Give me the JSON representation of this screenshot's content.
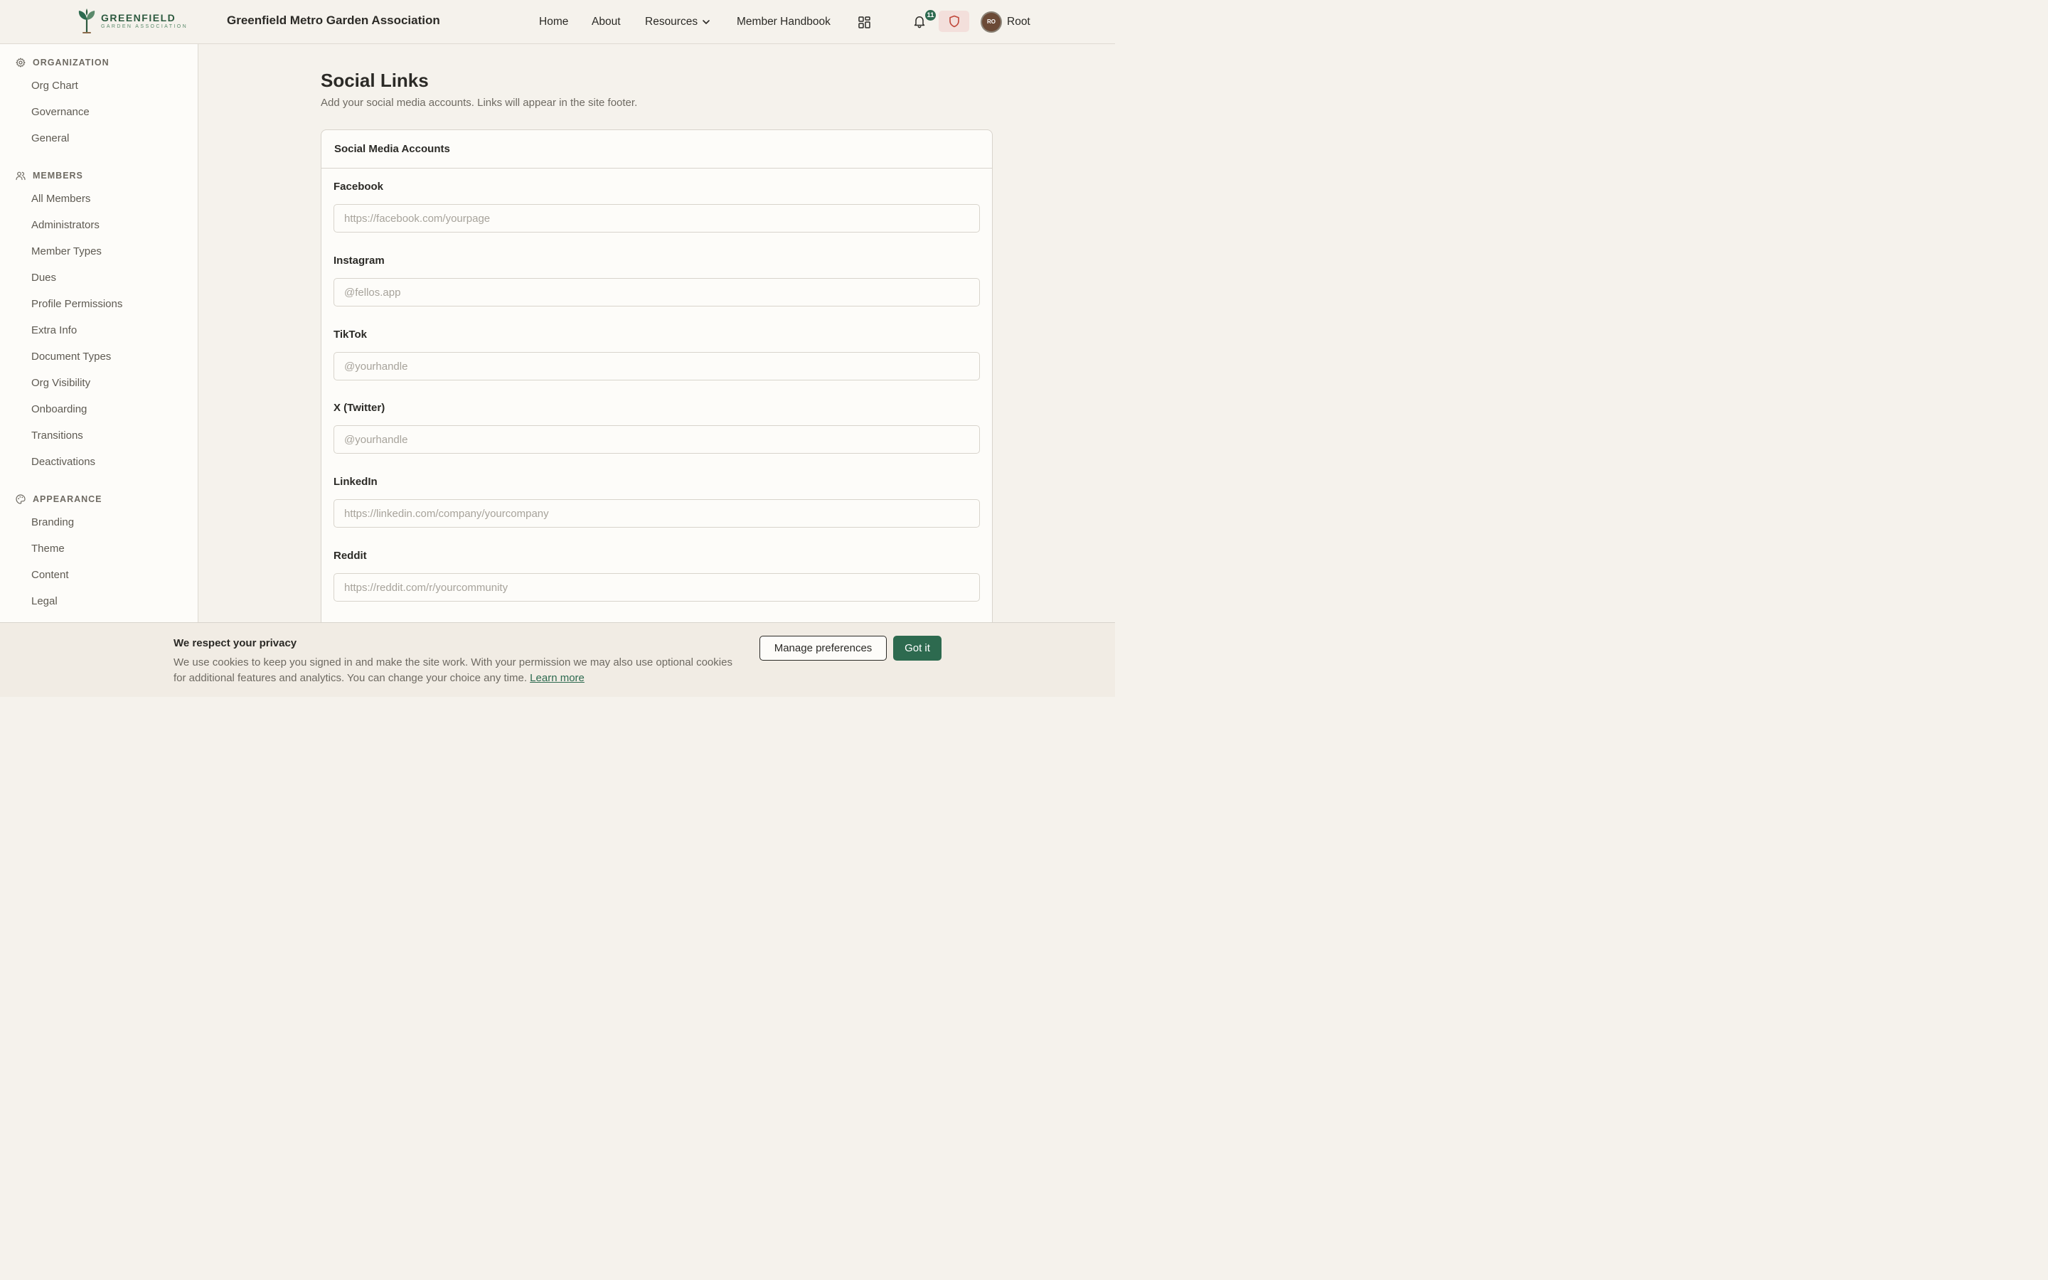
{
  "header": {
    "logo": {
      "name": "GREENFIELD",
      "sub": "GARDEN ASSOCIATION",
      "icon": "sprout-icon"
    },
    "site_title": "Greenfield Metro Garden Association",
    "nav": {
      "home": "Home",
      "about": "About",
      "resources": "Resources",
      "handbook": "Member Handbook"
    },
    "notifications_count": "11",
    "user": {
      "initials": "RO",
      "name": "Root"
    },
    "colors": {
      "brand": "#2d6a4f",
      "alert_bg": "#f3dfdb",
      "alert_icon": "#c0473a"
    }
  },
  "sidebar": {
    "sections": [
      {
        "label": "ORGANIZATION",
        "icon": "gear-icon",
        "items": [
          "Org Chart",
          "Governance",
          "General"
        ]
      },
      {
        "label": "MEMBERS",
        "icon": "users-icon",
        "items": [
          "All Members",
          "Administrators",
          "Member Types",
          "Dues",
          "Profile Permissions",
          "Extra Info",
          "Document Types",
          "Org Visibility",
          "Onboarding",
          "Transitions",
          "Deactivations"
        ]
      },
      {
        "label": "APPEARANCE",
        "icon": "palette-icon",
        "items": [
          "Branding",
          "Theme",
          "Content",
          "Legal"
        ]
      }
    ]
  },
  "main": {
    "title": "Social Links",
    "subtitle": "Add your social media accounts. Links will appear in the site footer.",
    "card_title": "Social Media Accounts",
    "fields": [
      {
        "label": "Facebook",
        "value": "",
        "placeholder": "https://facebook.com/yourpage"
      },
      {
        "label": "Instagram",
        "value": "",
        "placeholder": "@fellos.app"
      },
      {
        "label": "TikTok",
        "value": "",
        "placeholder": "@yourhandle"
      },
      {
        "label": "X (Twitter)",
        "value": "",
        "placeholder": "@yourhandle"
      },
      {
        "label": "LinkedIn",
        "value": "",
        "placeholder": "https://linkedin.com/company/yourcompany"
      },
      {
        "label": "Reddit",
        "value": "",
        "placeholder": "https://reddit.com/r/yourcommunity"
      }
    ]
  },
  "cookie": {
    "title": "We respect your privacy",
    "text": "We use cookies to keep you signed in and make the site work. With your permission we may also use optional cookies for additional features and analytics. You can change your choice any time.",
    "link": "Learn more",
    "manage_label": "Manage preferences",
    "accept_label": "Got it"
  }
}
